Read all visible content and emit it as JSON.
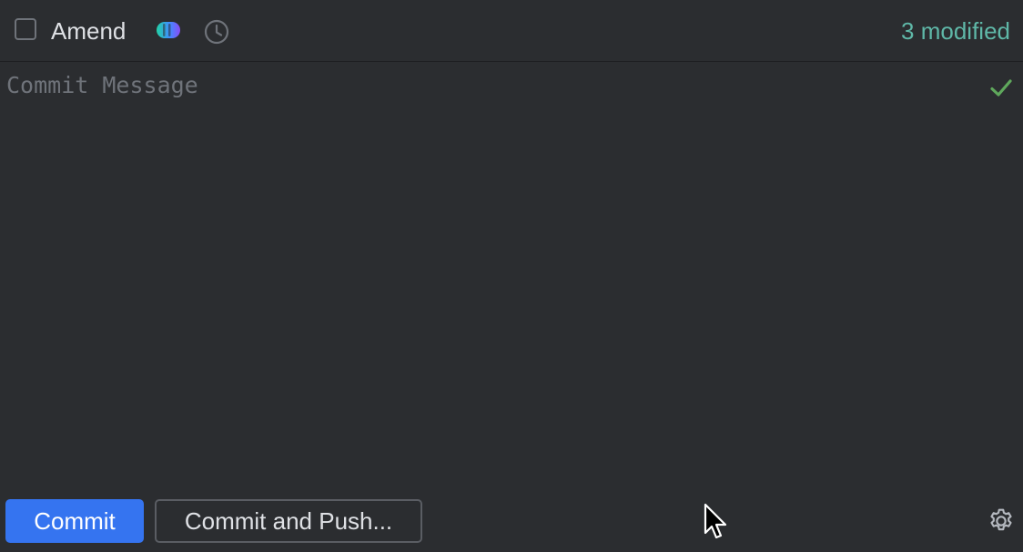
{
  "toolbar": {
    "amend_label": "Amend",
    "amend_checked": false,
    "ai_icon": "ai-assistant-icon",
    "history_icon": "clock-icon",
    "modified_text": "3 modified"
  },
  "message": {
    "placeholder": "Commit Message",
    "value": "",
    "status_icon": "check-icon"
  },
  "actions": {
    "commit_label": "Commit",
    "commit_push_label": "Commit and Push...",
    "settings_icon": "gear-icon"
  },
  "colors": {
    "background": "#2b2d30",
    "accent_blue": "#3574f0",
    "modified_teal": "#5fb8a8",
    "check_green": "#5fa85c",
    "text": "#dfe1e5",
    "muted": "#6f737a"
  }
}
